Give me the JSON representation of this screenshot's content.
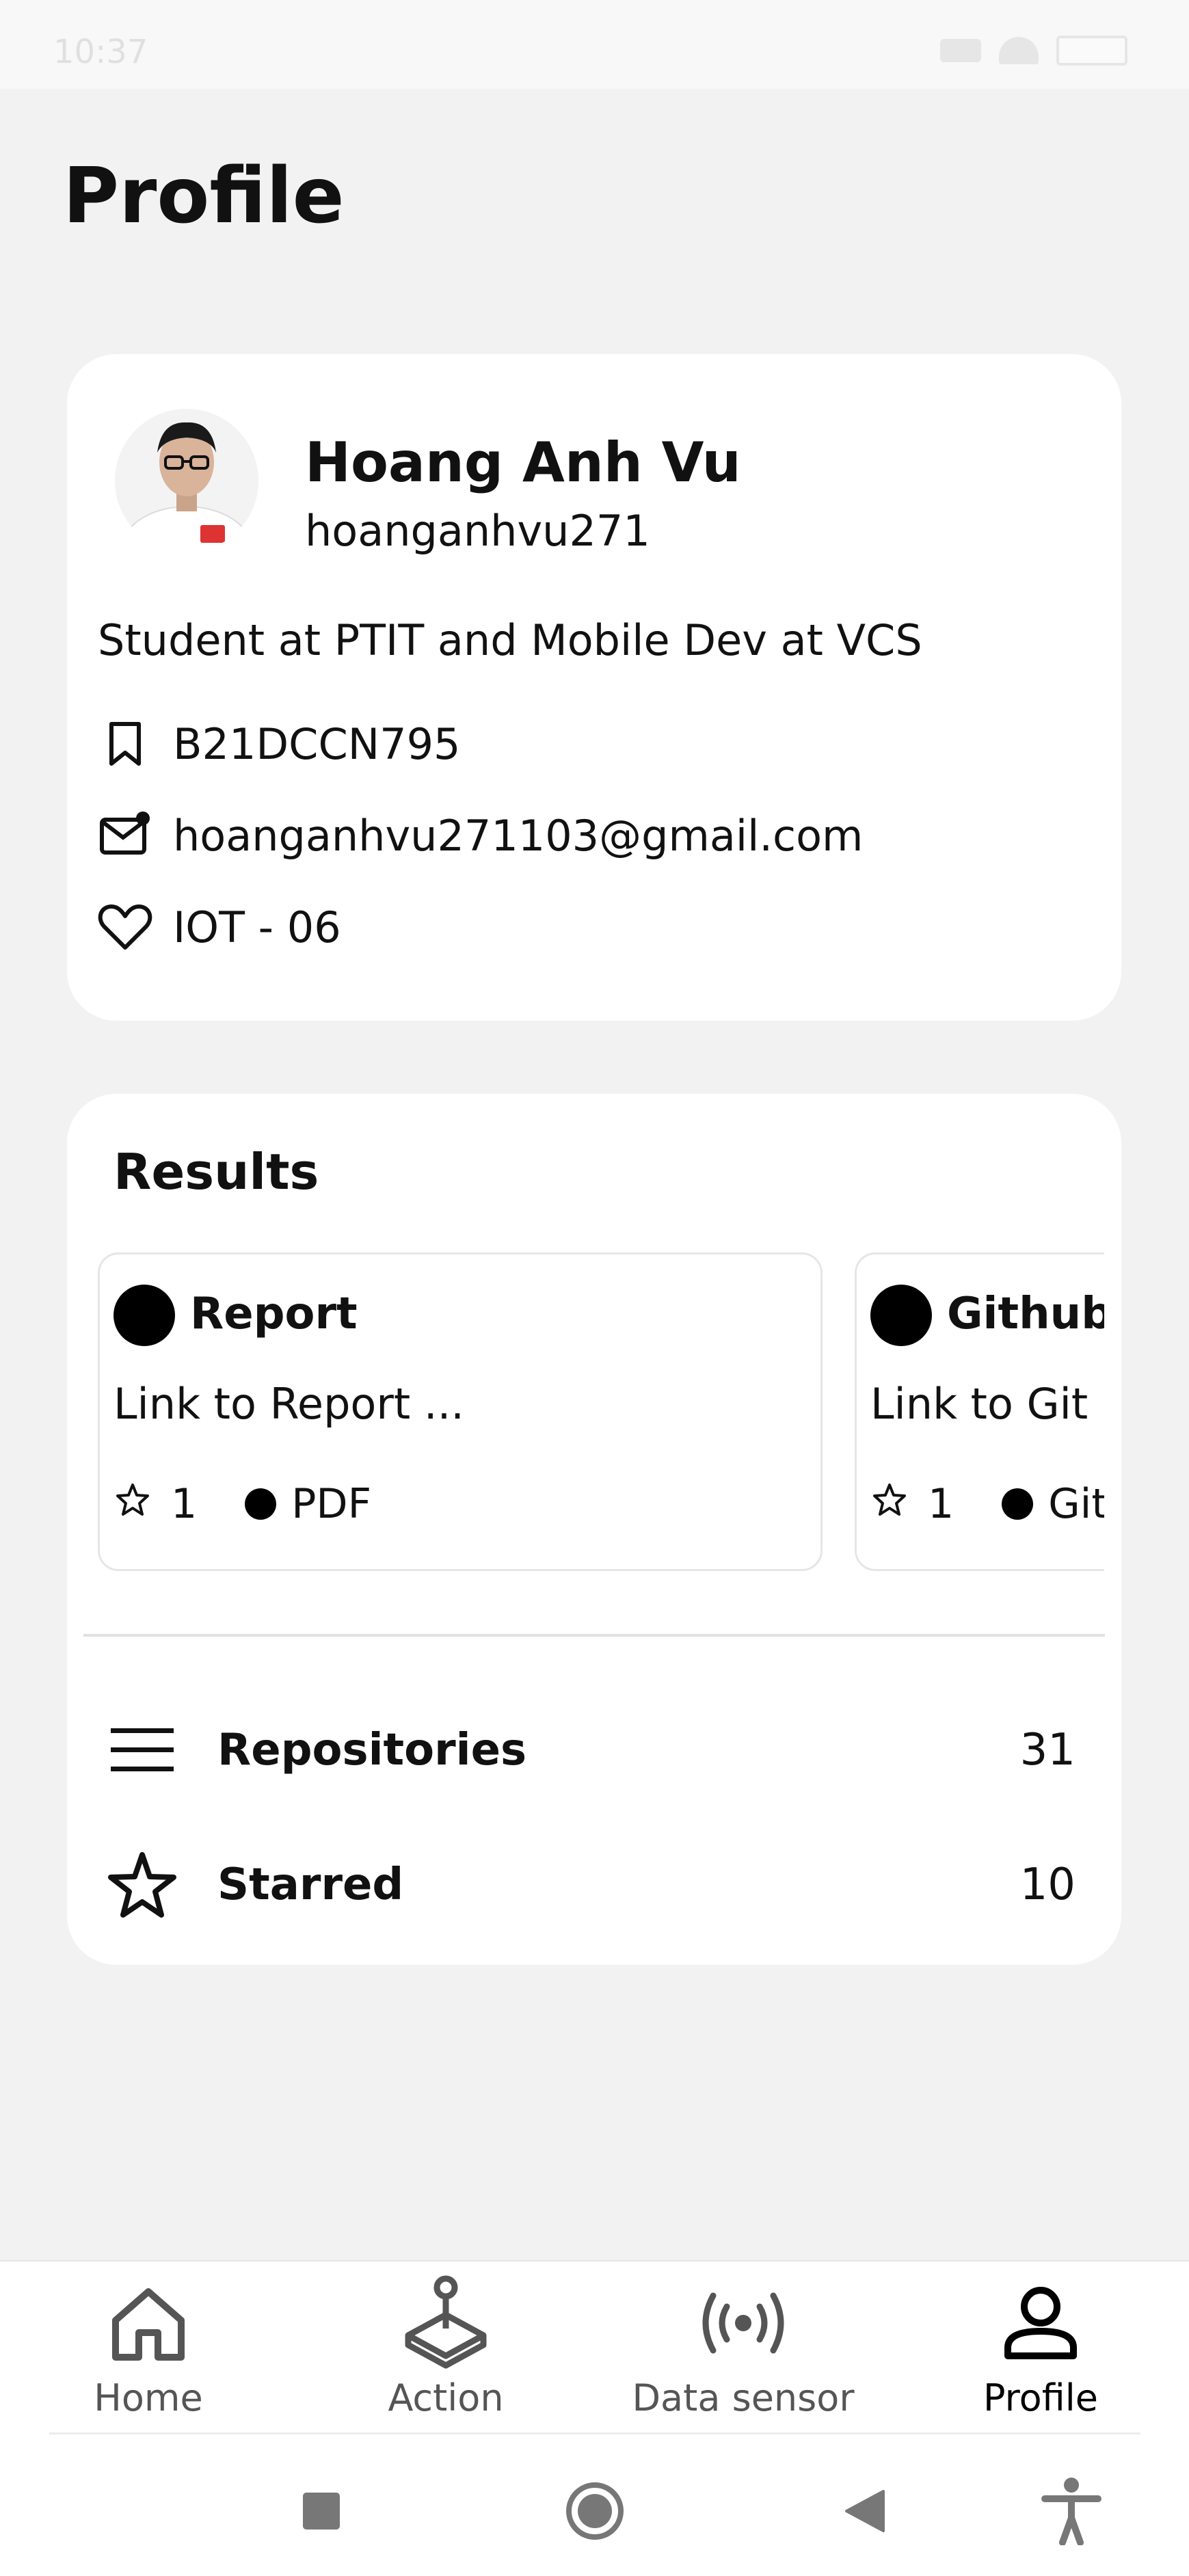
{
  "status_bar": {
    "time": "10:37"
  },
  "page_title": "Profile",
  "profile": {
    "name": "Hoang Anh Vu",
    "username": "hoanganhvu271",
    "bio": "Student at PTIT and Mobile Dev at VCS",
    "student_id": "B21DCCN795",
    "email": "hoanganhvu271103@gmail.com",
    "group": "IOT - 06"
  },
  "results": {
    "title": "Results",
    "cards": [
      {
        "name": "Report",
        "description": "Link to Report ...",
        "stars": "1",
        "language": "PDF"
      },
      {
        "name": "Github Repo",
        "description": "Link to Git Project",
        "stars": "1",
        "language": "Github"
      }
    ],
    "list": [
      {
        "label": "Repositories",
        "count": "31",
        "icon": "menu-icon"
      },
      {
        "label": "Starred",
        "count": "10",
        "icon": "star-icon"
      }
    ]
  },
  "bottom_nav": {
    "items": [
      {
        "label": "Home",
        "icon": "home-icon"
      },
      {
        "label": "Action",
        "icon": "joystick-icon"
      },
      {
        "label": "Data sensor",
        "icon": "sensor-icon"
      },
      {
        "label": "Profile",
        "icon": "person-icon"
      }
    ],
    "active": "Profile"
  }
}
